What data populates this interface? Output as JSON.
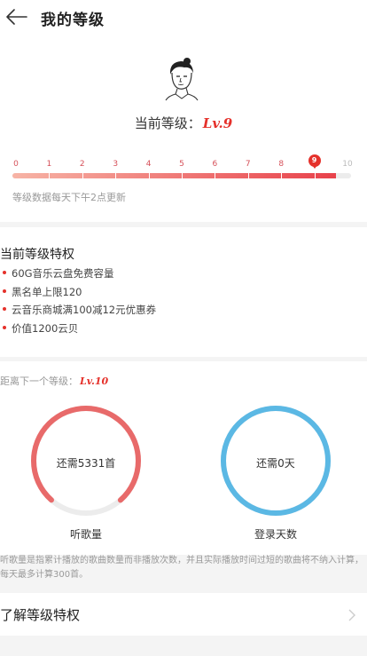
{
  "header": {
    "title": "我的等级",
    "back_icon": "arrow-left-icon"
  },
  "level": {
    "current_label": "当前等级：",
    "current_value": "Lv.9",
    "ticks": [
      "0",
      "1",
      "2",
      "3",
      "4",
      "5",
      "6",
      "7",
      "8",
      "9",
      "10"
    ],
    "current_index": 9,
    "progress_fraction": 0.955,
    "update_note": "等级数据每天下午2点更新"
  },
  "privileges": {
    "title": "当前等级特权",
    "items": [
      "60G音乐云盘免费容量",
      "黑名单上限120",
      "云音乐商城满100减12元优惠券",
      "价值1200云贝"
    ]
  },
  "next_level": {
    "label": "距离下一个等级：",
    "value": "Lv.10",
    "listen": {
      "text": "还需5331首",
      "caption": "听歌量",
      "progress": 0.77,
      "color": "#e86a6a"
    },
    "login": {
      "text": "还需0天",
      "caption": "登录天数",
      "progress": 1.0,
      "color": "#5bb8e4"
    }
  },
  "note": "听歌量是指累计播放的歌曲数量而非播放次数，并且实际播放时间过短的歌曲将不纳入计算，每天最多计算300首。",
  "learn_more": {
    "label": "了解等级特权",
    "chevron_icon": "chevron-right-icon"
  },
  "colors": {
    "accent": "#e5312b",
    "ring_track": "#ececec"
  }
}
